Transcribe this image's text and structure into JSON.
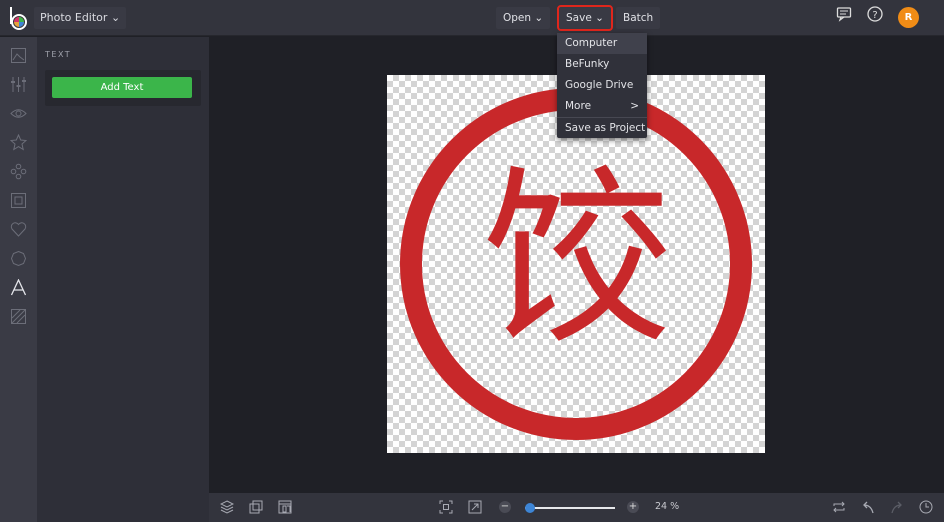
{
  "app": {
    "title": "Photo Editor",
    "user_initial": "R",
    "accent": "#3bb54a"
  },
  "toolbar": {
    "open": "Open",
    "save": "Save",
    "batch": "Batch"
  },
  "save_menu": {
    "items": [
      "Computer",
      "BeFunky",
      "Google Drive",
      "More",
      "Save as Project"
    ],
    "more_arrow": ">"
  },
  "panel": {
    "title": "TEXT",
    "add_text": "Add Text"
  },
  "image": {
    "character": "饺",
    "ring_color": "#c8282a"
  },
  "zoom": {
    "value": "24 %",
    "slider_fraction": 0.05,
    "minus": "−",
    "plus": "+"
  }
}
